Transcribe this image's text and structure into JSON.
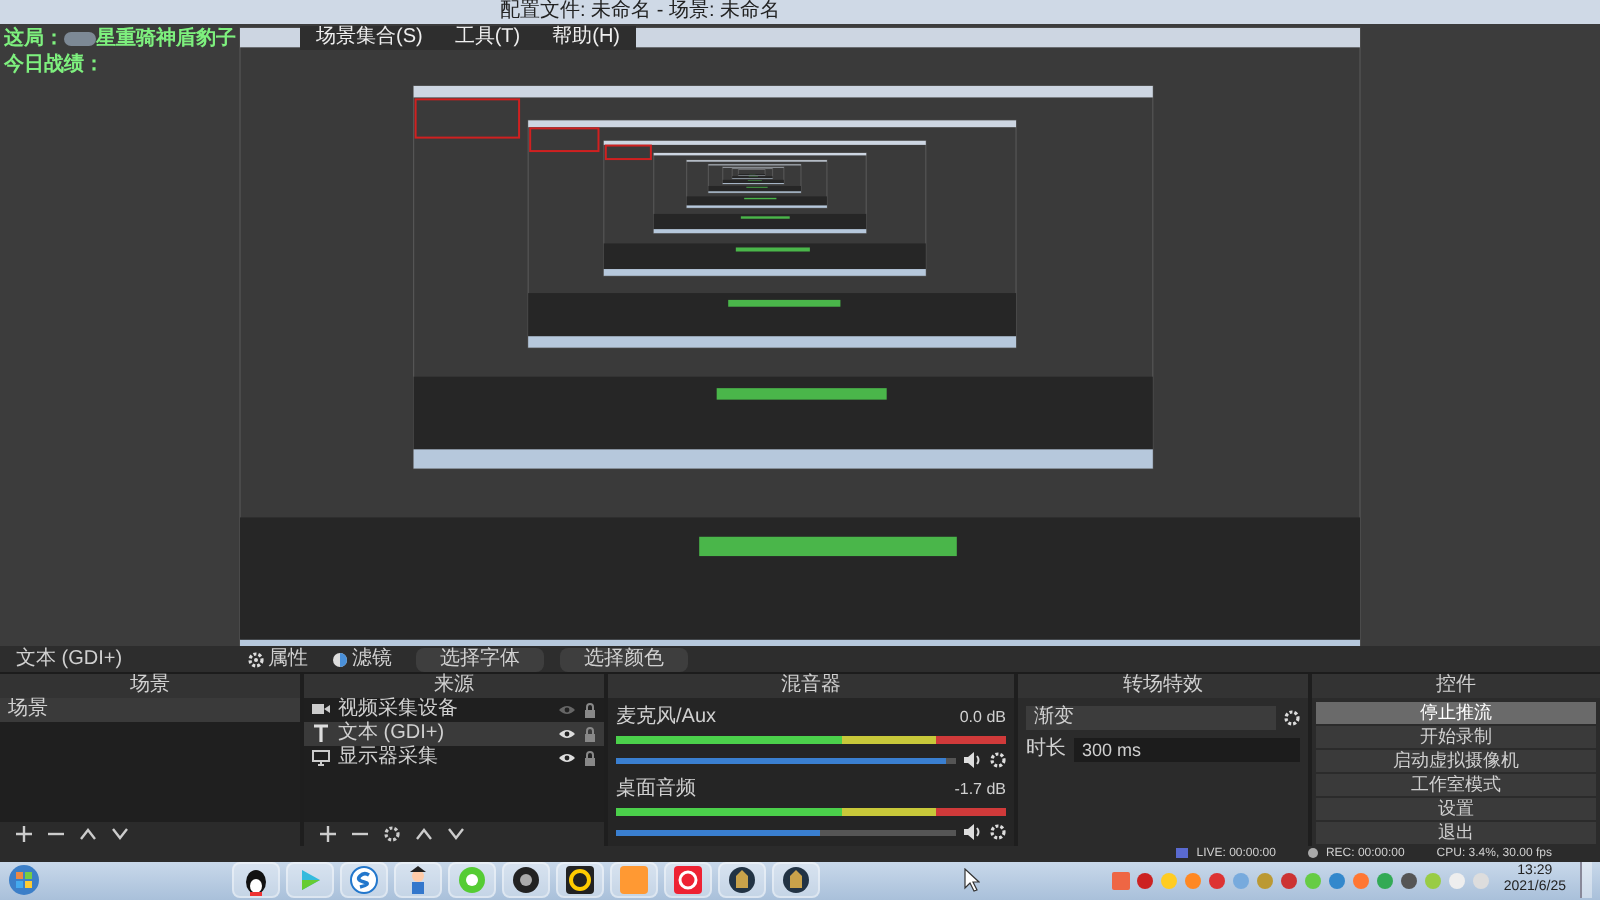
{
  "preview": {
    "title": "配置文件: 未命名 - 场景: 未命名",
    "menu": [
      "场景集合(S)",
      "工具(T)",
      "帮助(H)"
    ],
    "overlay_line_1_prefix": "这局：",
    "overlay_line_1_suffix": "星重骑神盾豹子",
    "overlay_line_2": "今日战绩："
  },
  "source_toolbar": {
    "label": "文本 (GDI+)",
    "buttons": [
      {
        "kind": "gear",
        "label": "属性"
      },
      {
        "kind": "filter",
        "label": "滤镜"
      },
      {
        "kind": "plain",
        "label": "选择字体"
      },
      {
        "kind": "plain",
        "label": "选择颜色"
      }
    ]
  },
  "scenes": {
    "title": "场景",
    "items": [
      {
        "label": "场景",
        "selected": true
      }
    ]
  },
  "sources": {
    "title": "来源",
    "items": [
      {
        "kind": "camera",
        "label": "视频采集设备",
        "visible": false,
        "selected": false
      },
      {
        "kind": "text",
        "label": "文本 (GDI+)",
        "visible": true,
        "selected": true
      },
      {
        "kind": "monitor",
        "label": "显示器采集",
        "visible": true,
        "selected": false
      }
    ]
  },
  "mixer": {
    "title": "混音器",
    "channels": [
      {
        "name": "麦克风/Aux",
        "reading": "0.0 dB",
        "level": 0.97
      },
      {
        "name": "桌面音频",
        "reading": "-1.7 dB",
        "level": 0.6
      }
    ]
  },
  "transitions": {
    "title": "转场特效",
    "selected": "渐变",
    "duration_label": "时长",
    "duration": "300 ms"
  },
  "controls": {
    "title": "控件",
    "buttons": [
      {
        "label": "停止推流",
        "active": true
      },
      {
        "label": "开始录制",
        "active": false
      },
      {
        "label": "启动虚拟摄像机",
        "active": false
      },
      {
        "label": "工作室模式",
        "active": false
      },
      {
        "label": "设置",
        "active": false
      },
      {
        "label": "退出",
        "active": false
      }
    ]
  },
  "status_bar": {
    "live": "LIVE: 00:00:00",
    "rec": "REC: 00:00:00",
    "cpu": "CPU: 3.4%, 30.00 fps"
  },
  "taskbar": {
    "time": "13:29",
    "date": "2021/6/25"
  }
}
